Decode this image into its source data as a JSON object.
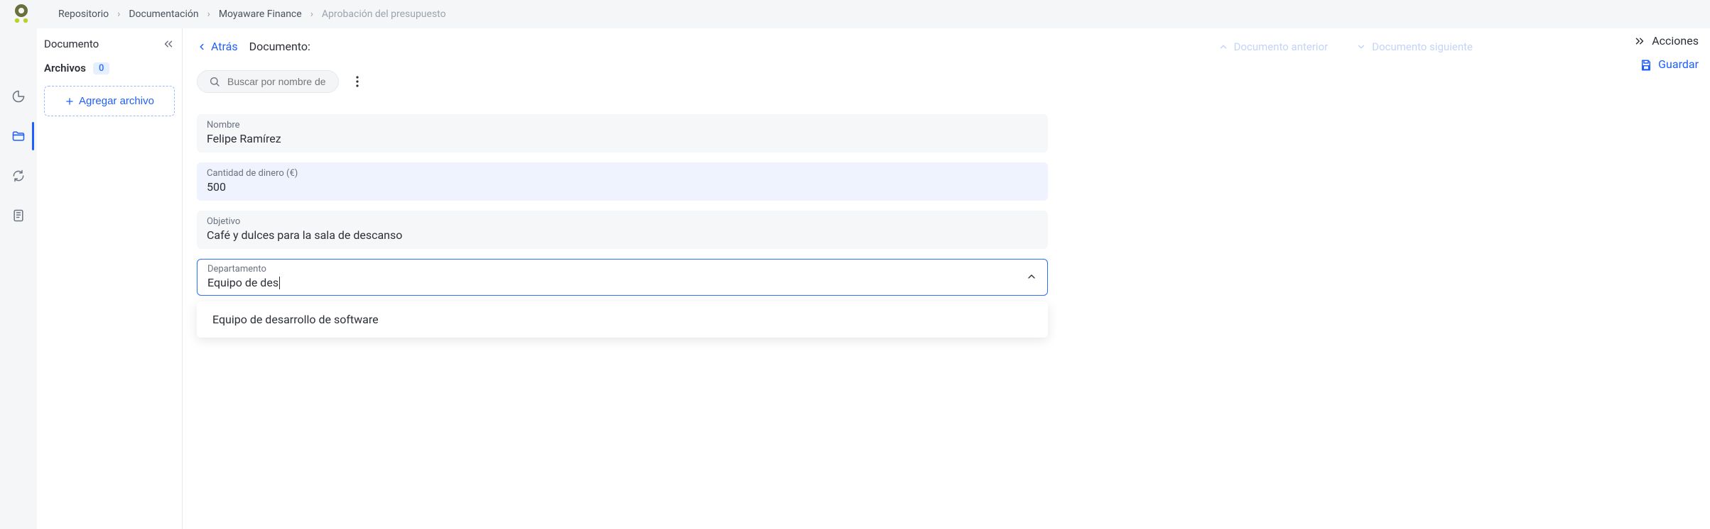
{
  "breadcrumbs": {
    "items": [
      "Repositorio",
      "Documentación",
      "Moyaware Finance",
      "Aprobación del presupuesto"
    ]
  },
  "sidepanel": {
    "title": "Documento",
    "files_label": "Archivos",
    "files_count": "0",
    "add_file_label": "Agregar archivo"
  },
  "header": {
    "back_label": "Atrás",
    "doc_label": "Documento:",
    "prev_label": "Documento anterior",
    "next_label": "Documento siguiente",
    "actions_label": "Acciones",
    "save_label": "Guardar"
  },
  "search": {
    "placeholder": "Buscar por nombre de cam"
  },
  "fields": {
    "name_label": "Nombre",
    "name_value": "Felipe Ramírez",
    "amount_label": "Cantidad de dinero (€)",
    "amount_value": "500",
    "objective_label": "Objetivo",
    "objective_value": "Café y dulces para la sala de descanso",
    "department_label": "Departamento",
    "department_typed": "Equipo de des"
  },
  "dropdown": {
    "option_0": "Equipo de desarrollo de software"
  }
}
